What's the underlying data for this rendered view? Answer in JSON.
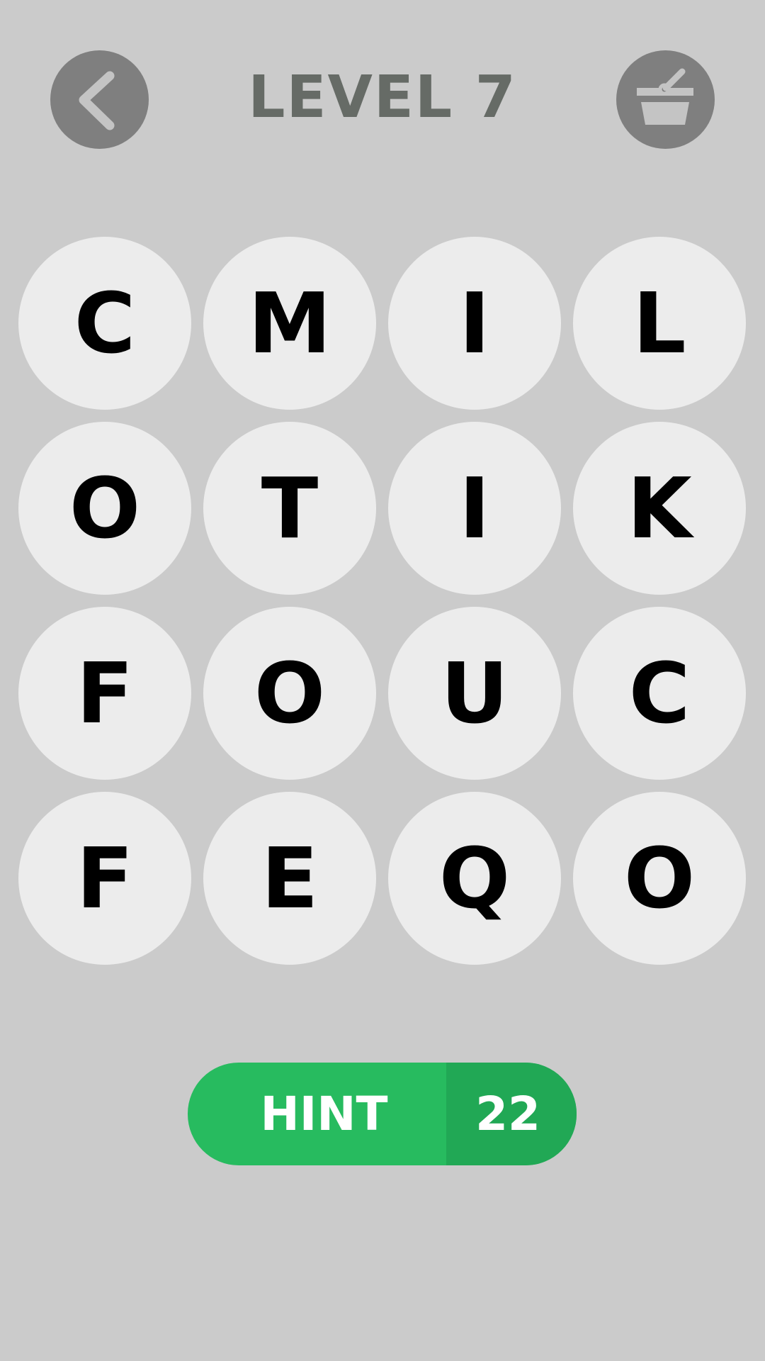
{
  "header": {
    "level_title": "LEVEL 7",
    "back_icon": "chevron-left-icon",
    "shop_icon": "shop-basket-icon"
  },
  "board": {
    "rows": [
      [
        "C",
        "M",
        "I",
        "L"
      ],
      [
        "O",
        "T",
        "I",
        "K"
      ],
      [
        "F",
        "O",
        "U",
        "C"
      ],
      [
        "F",
        "E",
        "Q",
        "O"
      ]
    ]
  },
  "hint": {
    "label": "HINT",
    "count": "22"
  },
  "colors": {
    "background": "#cbcbcb",
    "tile": "#ececec",
    "icon_button": "#7f7f7f",
    "title": "#666b66",
    "hint_green": "#27bb5f",
    "hint_count_green": "#21a855"
  }
}
